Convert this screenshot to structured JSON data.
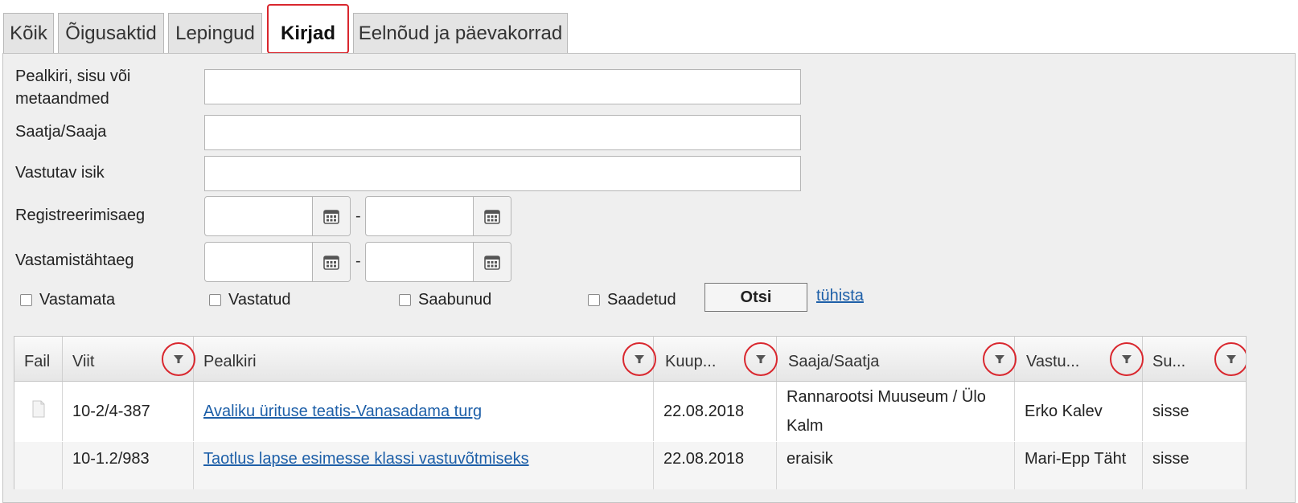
{
  "tabs": [
    "Kõik",
    "Õigusaktid",
    "Lepingud",
    "Kirjad",
    "Eelnõud ja päevakorrad"
  ],
  "active_tab": "Kirjad",
  "form": {
    "title_label_line1": "Pealkiri, sisu või",
    "title_label_line2": "metaandmed",
    "sender_label": "Saatja/Saaja",
    "responsible_label": "Vastutav isik",
    "registered_label": "Registreerimisaeg",
    "deadline_label": "Vastamistähtaeg",
    "range_separator": "-",
    "checkboxes": [
      "Vastamata",
      "Vastatud",
      "Saabunud",
      "Saadetud"
    ],
    "search_button": "Otsi",
    "cancel_link": "tühista"
  },
  "table": {
    "columns": [
      "Fail",
      "Viit",
      "Pealkiri",
      "Kuup...",
      "Saaja/Saatja",
      "Vastu...",
      "Su..."
    ],
    "rows": [
      {
        "ref": "10-2/4-387",
        "title": "Avaliku ürituse teatis-Vanasadama turg",
        "date": "22.08.2018",
        "party_line1": "Rannarootsi Muuseum / Ülo",
        "party_line2": "Kalm",
        "responsible": "Erko Kalev",
        "direction": "sisse",
        "has_file": true
      },
      {
        "ref": "10-1.2/983",
        "title": "Taotlus lapse esimesse klassi vastuvõtmiseks",
        "date": "22.08.2018",
        "party_line1": "eraisik",
        "party_line2": "",
        "responsible": "Mari-Epp Täht",
        "direction": "sisse",
        "has_file": false
      }
    ]
  },
  "colors": {
    "highlight": "#d9272e",
    "link": "#1d5fa8"
  }
}
